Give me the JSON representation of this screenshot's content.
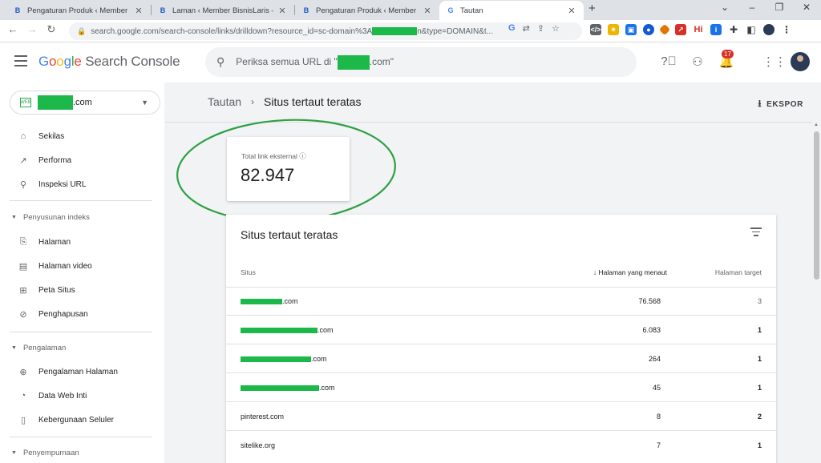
{
  "browser": {
    "tabs": [
      {
        "title": "Pengaturan Produk ‹ Member Bi",
        "favicon": "B"
      },
      {
        "title": "Laman ‹ Member BisnisLaris — W",
        "favicon": "B"
      },
      {
        "title": "Pengaturan Produk ‹ Member Bi",
        "favicon": "B"
      },
      {
        "title": "Tautan",
        "favicon": "G"
      }
    ],
    "url_start": "search.google.com/search-console/links/drilldown?resource_id=sc-domain%3A",
    "url_end": "n&type=DOMAIN&t...",
    "extension_hi": "Hi"
  },
  "header": {
    "logo_google": "Google",
    "logo_product": "Search Console",
    "search_placeholder_start": "Periksa semua URL di \"",
    "search_placeholder_end": ".com\"",
    "notification_count": "17"
  },
  "sidebar": {
    "property_suffix": ".com",
    "property_badge": "WEB",
    "items": [
      {
        "label": "Sekilas",
        "icon": "home-icon"
      },
      {
        "label": "Performa",
        "icon": "trending-up-icon"
      },
      {
        "label": "Inspeksi URL",
        "icon": "search-icon"
      }
    ],
    "sections": [
      {
        "label": "Penyusunan indeks",
        "items": [
          {
            "label": "Halaman",
            "icon": "file-icon"
          },
          {
            "label": "Halaman video",
            "icon": "video-page-icon"
          },
          {
            "label": "Peta Situs",
            "icon": "sitemap-icon"
          },
          {
            "label": "Penghapusan",
            "icon": "eye-off-icon"
          }
        ]
      },
      {
        "label": "Pengalaman",
        "items": [
          {
            "label": "Pengalaman Halaman",
            "icon": "plus-circle-icon"
          },
          {
            "label": "Data Web Inti",
            "icon": "gauge-icon"
          },
          {
            "label": "Kebergunaan Seluler",
            "icon": "phone-icon"
          }
        ]
      },
      {
        "label": "Penyempurnaan",
        "items": []
      }
    ]
  },
  "main": {
    "breadcrumb_root": "Tautan",
    "breadcrumb_current": "Situs tertaut teratas",
    "export_label": "EKSPOR",
    "stat_label": "Total link eksternal",
    "stat_value": "82.947",
    "table": {
      "title": "Situs tertaut teratas",
      "col_site": "Situs",
      "col_linking": "Halaman yang menaut",
      "col_target": "Halaman target",
      "rows": [
        {
          "site_suffix": ".com",
          "linking": "76.568",
          "target": "3"
        },
        {
          "site_suffix": ".com",
          "linking": "6.083",
          "target": "1"
        },
        {
          "site_suffix": ".com",
          "linking": "264",
          "target": "1"
        },
        {
          "site_suffix": ".com",
          "linking": "45",
          "target": "1"
        },
        {
          "site": "pinterest.com",
          "linking": "8",
          "target": "2"
        },
        {
          "site": "sitelike.org",
          "linking": "7",
          "target": "1"
        }
      ]
    }
  },
  "colors": {
    "annotation_circle": "#2ea043",
    "redaction": "#1db84a",
    "accent_blue": "#1a73e8"
  }
}
